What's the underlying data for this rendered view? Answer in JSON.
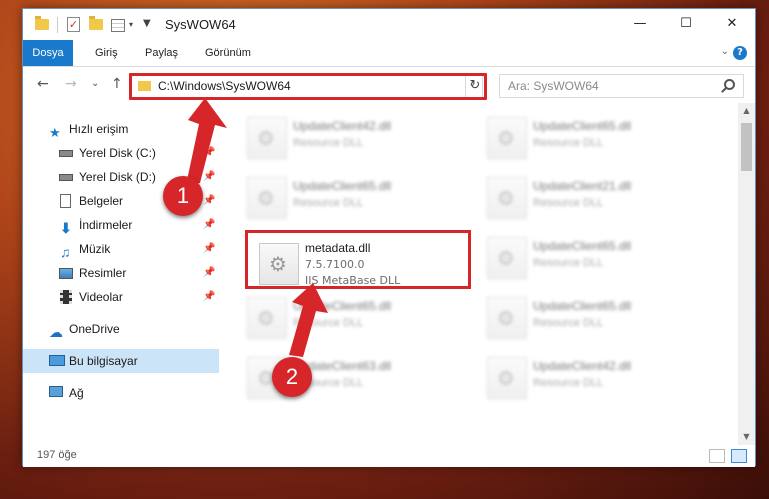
{
  "window": {
    "title": "SysWOW64",
    "minimize_glyph": "—",
    "maximize_glyph": "☐",
    "close_glyph": "✕"
  },
  "ribbon": {
    "tabs": [
      {
        "label": "Dosya",
        "active": true
      },
      {
        "label": "Giriş"
      },
      {
        "label": "Paylaş"
      },
      {
        "label": "Görünüm"
      }
    ],
    "help_glyph": "?",
    "collapse_glyph": "⌄"
  },
  "nav": {
    "back_glyph": "←",
    "forward_glyph": "→",
    "recent_glyph": "⌄",
    "up_glyph": "↑",
    "address": "C:\\Windows\\SysWOW64",
    "address_dropdown_glyph": "⌄",
    "refresh_glyph": "↻",
    "search_placeholder": "Ara: SysWOW64"
  },
  "sidebar": {
    "items": [
      {
        "label": "Hızlı erişim",
        "icon": "star-icon"
      },
      {
        "label": "Yerel Disk (C:)",
        "icon": "drive-icon",
        "pinned": true
      },
      {
        "label": "Yerel Disk (D:)",
        "icon": "drive-icon",
        "pinned": true
      },
      {
        "label": "Belgeler",
        "icon": "document-icon",
        "pinned": true
      },
      {
        "label": "İndirmeler",
        "icon": "download-icon",
        "pinned": true
      },
      {
        "label": "Müzik",
        "icon": "music-icon",
        "pinned": true
      },
      {
        "label": "Resimler",
        "icon": "pictures-icon",
        "pinned": true
      },
      {
        "label": "Videolar",
        "icon": "video-icon",
        "pinned": true
      },
      {
        "label": "OneDrive",
        "icon": "cloud-icon"
      },
      {
        "label": "Bu bilgisayar",
        "icon": "computer-icon",
        "selected": true
      },
      {
        "label": "Ağ",
        "icon": "network-icon"
      }
    ],
    "pin_glyph": "📌"
  },
  "files": {
    "highlighted": {
      "name": "metadata.dll",
      "version": "7.5.7100.0",
      "description": "IIS MetaBase DLL"
    },
    "left_column": [
      {
        "name": "UpdateClient42.dll",
        "description": "Resource DLL"
      },
      {
        "name": "UpdateClient65.dll",
        "description": "Resource DLL"
      },
      {
        "name": "UpdateClient65.dll",
        "description": "Resource DLL"
      },
      {
        "name": "UpdateClient63.dll",
        "description": "Resource DLL"
      }
    ],
    "right_column": [
      {
        "name": "UpdateClient65.dll",
        "description": "Resource DLL"
      },
      {
        "name": "UpdateClient21.dll",
        "description": "Resource DLL"
      },
      {
        "name": "UpdateClient65.dll",
        "description": "Resource DLL"
      },
      {
        "name": "UpdateClient65.dll",
        "description": "Resource DLL"
      },
      {
        "name": "UpdateClient42.dll",
        "description": "Resource DLL"
      }
    ]
  },
  "status": {
    "count": "197 öğe"
  },
  "annotations": {
    "step1": "1",
    "step2": "2",
    "color": "#d7262a"
  },
  "colors": {
    "accent": "#1979ca",
    "selection": "#cce4f7"
  }
}
